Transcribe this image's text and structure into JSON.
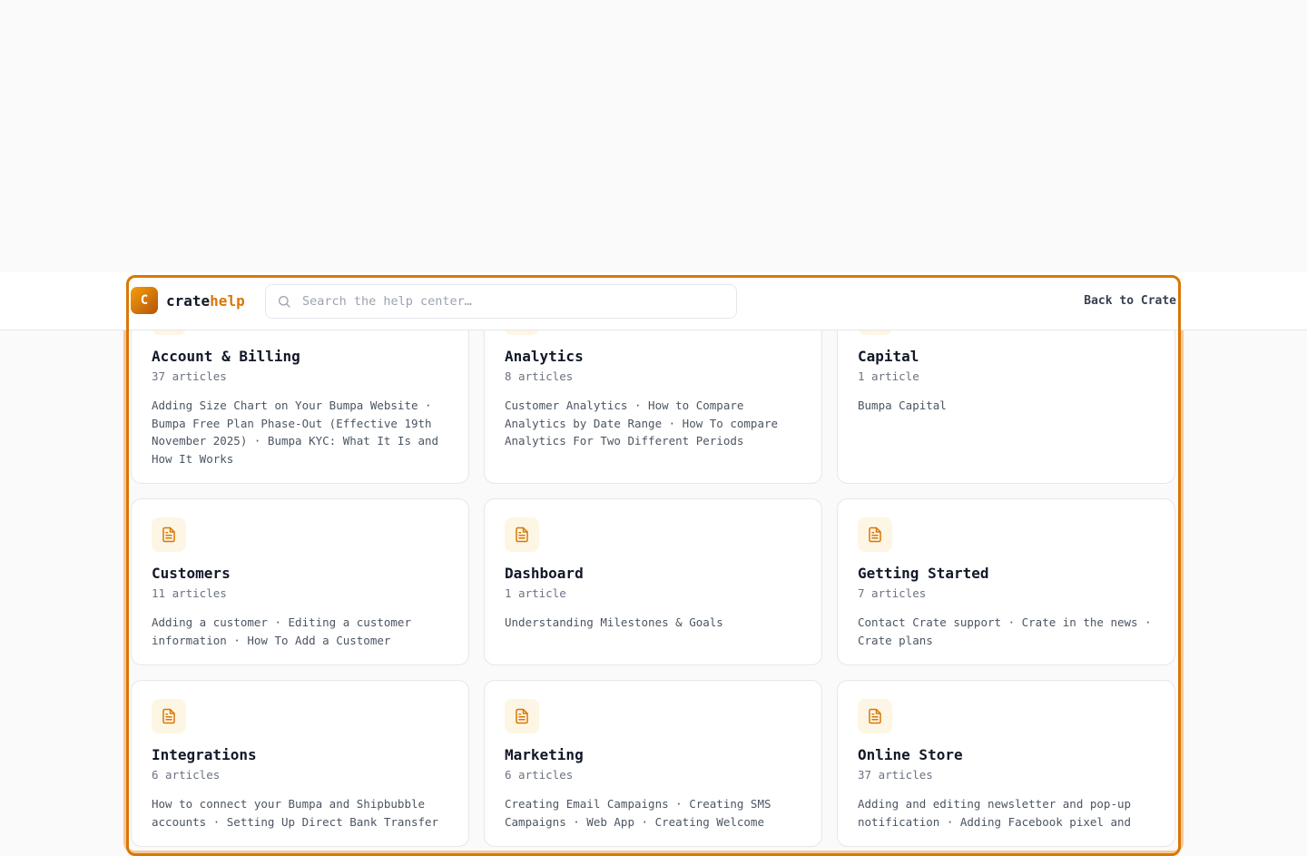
{
  "header": {
    "logo_letter": "C",
    "brand_part1": "crate",
    "brand_part2": "help",
    "search_placeholder": "Search the help center…",
    "back_link": "Back to Crate"
  },
  "colors": {
    "accent": "#d97706",
    "icon_bg": "#fef6e4"
  },
  "categories": [
    {
      "icon": "document-icon",
      "title": "Account & Billing",
      "count": "37 articles",
      "desc": "Adding Size Chart on Your Bumpa Website · Bumpa Free Plan Phase-Out (Effective 19th November 2025) · Bumpa KYC: What It Is and How It Works"
    },
    {
      "icon": "document-icon",
      "title": "Analytics",
      "count": "8 articles",
      "desc": "Customer Analytics · How to Compare Analytics by Date Range · How To compare Analytics For Two Different Periods"
    },
    {
      "icon": "document-icon",
      "title": "Capital",
      "count": "1 article",
      "desc": "Bumpa Capital"
    },
    {
      "icon": "document-icon",
      "title": "Customers",
      "count": "11 articles",
      "desc": "Adding a customer · Editing a customer information · How To Add a Customer"
    },
    {
      "icon": "document-icon",
      "title": "Dashboard",
      "count": "1 article",
      "desc": "Understanding Milestones & Goals"
    },
    {
      "icon": "document-icon",
      "title": "Getting Started",
      "count": "7 articles",
      "desc": "Contact Crate support · Crate in the news · Crate plans"
    },
    {
      "icon": "document-icon",
      "title": "Integrations",
      "count": "6 articles",
      "desc": "How to connect your Bumpa and Shipbubble accounts · Setting Up Direct Bank Transfer"
    },
    {
      "icon": "document-icon",
      "title": "Marketing",
      "count": "6 articles",
      "desc": "Creating Email Campaigns · Creating SMS Campaigns · Web App · Creating Welcome"
    },
    {
      "icon": "document-icon",
      "title": "Online Store",
      "count": "37 articles",
      "desc": "Adding and editing newsletter and pop-up notification · Adding Facebook pixel and"
    }
  ]
}
